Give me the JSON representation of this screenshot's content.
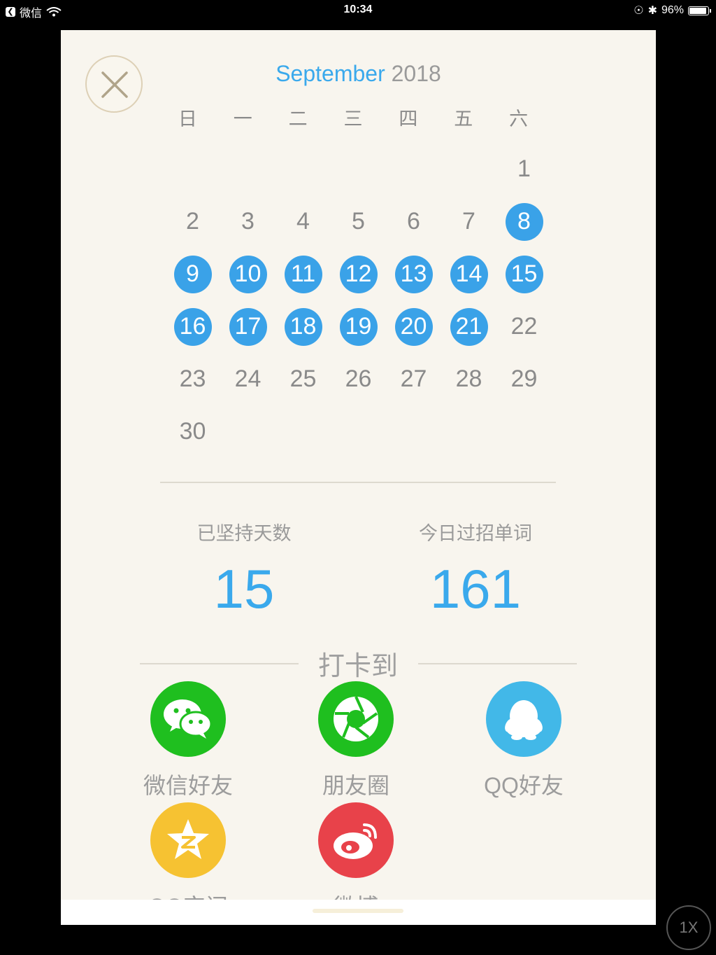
{
  "status_bar": {
    "back_app": "微信",
    "time": "10:34",
    "battery": "96%"
  },
  "calendar": {
    "month": "September",
    "year": "2018",
    "weekdays": [
      "日",
      "一",
      "二",
      "三",
      "四",
      "五",
      "六"
    ],
    "weeks": [
      [
        null,
        null,
        null,
        null,
        null,
        null,
        {
          "d": "1",
          "checked": false
        }
      ],
      [
        {
          "d": "2",
          "checked": false
        },
        {
          "d": "3",
          "checked": false
        },
        {
          "d": "4",
          "checked": false
        },
        {
          "d": "5",
          "checked": false
        },
        {
          "d": "6",
          "checked": false
        },
        {
          "d": "7",
          "checked": false
        },
        {
          "d": "8",
          "checked": true
        }
      ],
      [
        {
          "d": "9",
          "checked": true
        },
        {
          "d": "10",
          "checked": true
        },
        {
          "d": "11",
          "checked": true
        },
        {
          "d": "12",
          "checked": true
        },
        {
          "d": "13",
          "checked": true
        },
        {
          "d": "14",
          "checked": true
        },
        {
          "d": "15",
          "checked": true
        }
      ],
      [
        {
          "d": "16",
          "checked": true
        },
        {
          "d": "17",
          "checked": true
        },
        {
          "d": "18",
          "checked": true
        },
        {
          "d": "19",
          "checked": true
        },
        {
          "d": "20",
          "checked": true
        },
        {
          "d": "21",
          "checked": true
        },
        {
          "d": "22",
          "checked": false
        }
      ],
      [
        {
          "d": "23",
          "checked": false
        },
        {
          "d": "24",
          "checked": false
        },
        {
          "d": "25",
          "checked": false
        },
        {
          "d": "26",
          "checked": false
        },
        {
          "d": "27",
          "checked": false
        },
        {
          "d": "28",
          "checked": false
        },
        {
          "d": "29",
          "checked": false
        }
      ],
      [
        {
          "d": "30",
          "checked": false
        },
        null,
        null,
        null,
        null,
        null,
        null
      ]
    ]
  },
  "stats": {
    "days_label": "已坚持天数",
    "days_value": "15",
    "words_label": "今日过招单词",
    "words_value": "161"
  },
  "share": {
    "title": "打卡到",
    "targets": [
      {
        "name": "微信好友",
        "icon": "wechat-icon",
        "color": "#1fbf1f"
      },
      {
        "name": "朋友圈",
        "icon": "moments-icon",
        "color": "#1fbf1f"
      },
      {
        "name": "QQ好友",
        "icon": "qq-icon",
        "color": "#42b8e8"
      },
      {
        "name": "QQ空间",
        "icon": "qzone-icon",
        "color": "#f6c232"
      },
      {
        "name": "微博",
        "icon": "weibo-icon",
        "color": "#e8424a"
      }
    ]
  },
  "zoom_label": "1X",
  "colors": {
    "accent": "#3aa9ec",
    "checked_day": "#3aa2e8",
    "card_bg": "#f8f5ee"
  }
}
